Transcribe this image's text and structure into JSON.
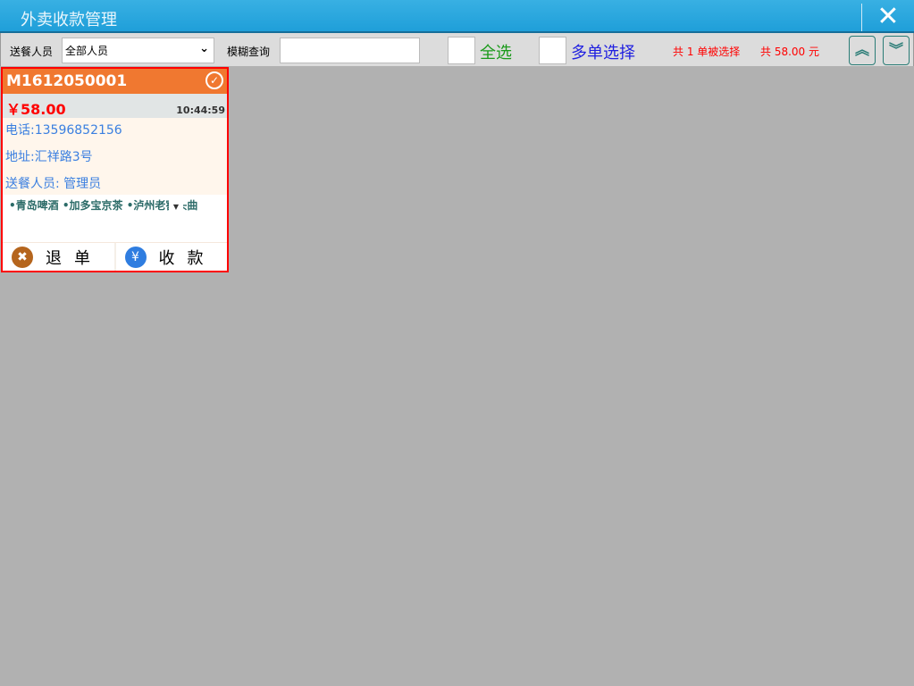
{
  "window": {
    "title": "外卖收款管理"
  },
  "toolbar": {
    "courier_label": "送餐人员",
    "courier_value": "全部人员",
    "search_label": "模糊查询",
    "search_value": "",
    "select_all": "全选",
    "multi_select": "多单选择",
    "selected_count": "共 1 单被选择",
    "selected_total": "共 58.00 元"
  },
  "order": {
    "id": "M1612050001",
    "amount": "￥58.00",
    "time": "10:44:59",
    "phone": "电话:13596852156",
    "address": "地址:汇祥路3号",
    "courier": "送餐人员: 管理员",
    "items": "•青岛啤酒 •加多宝京茶 •泸州老窖头曲",
    "refund": "退单",
    "collect": "收款"
  }
}
